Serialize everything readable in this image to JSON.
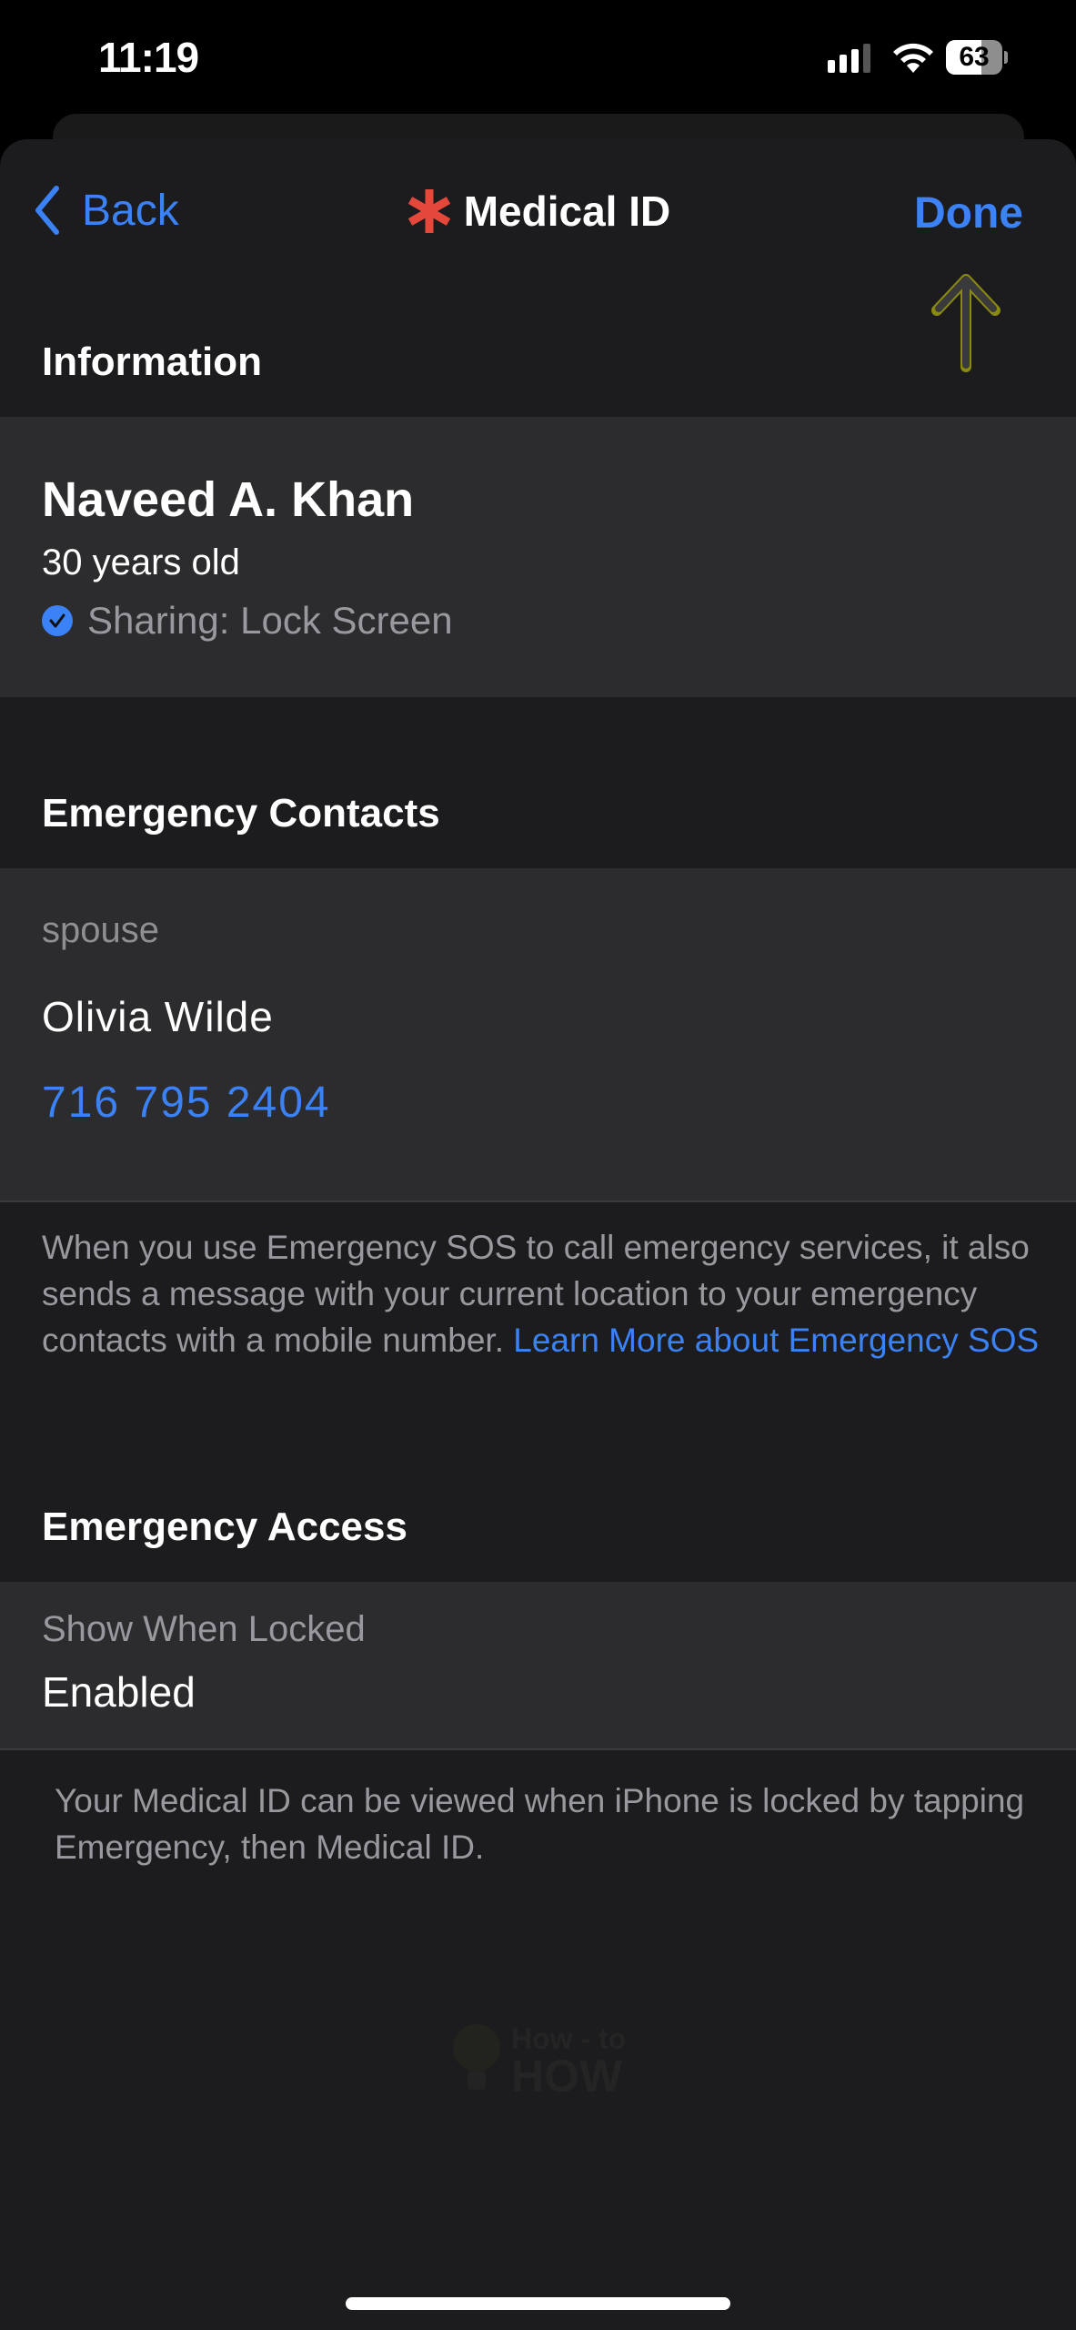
{
  "status_bar": {
    "time": "11:19",
    "battery_percent": 63,
    "battery_label": "63",
    "signal_bars_active": 3,
    "signal_bars_total": 4,
    "wifi": "wifi-icon"
  },
  "nav": {
    "back_label": "Back",
    "title": "Medical ID",
    "title_icon": "medical-asterisk-icon",
    "done_label": "Done",
    "annotation": "arrow-up-icon"
  },
  "information": {
    "header": "Information",
    "name": "Naveed A. Khan",
    "age": "30 years old",
    "sharing": "Sharing: Lock Screen"
  },
  "emergency_contacts": {
    "header": "Emergency Contacts",
    "contacts": [
      {
        "relation": "spouse",
        "name": "Olivia Wilde",
        "phone": "716 795 2404"
      }
    ],
    "footnote": "When you use Emergency SOS to call emergency services, it also sends a message with your current location to your emergency contacts with a mobile number. ",
    "footnote_link": "Learn More about Emergency SOS"
  },
  "emergency_access": {
    "header": "Emergency Access",
    "field_label": "Show When Locked",
    "field_value": "Enabled",
    "footnote": "Your Medical ID can be viewed when iPhone is locked by tapping Emergency, then Medical ID."
  },
  "watermark": {
    "line1": "How - to",
    "line2": "HOW"
  },
  "colors": {
    "accent": "#3b82f6",
    "asterisk": "#e5483b",
    "background": "#1c1c1e",
    "card": "#2c2c2e"
  }
}
